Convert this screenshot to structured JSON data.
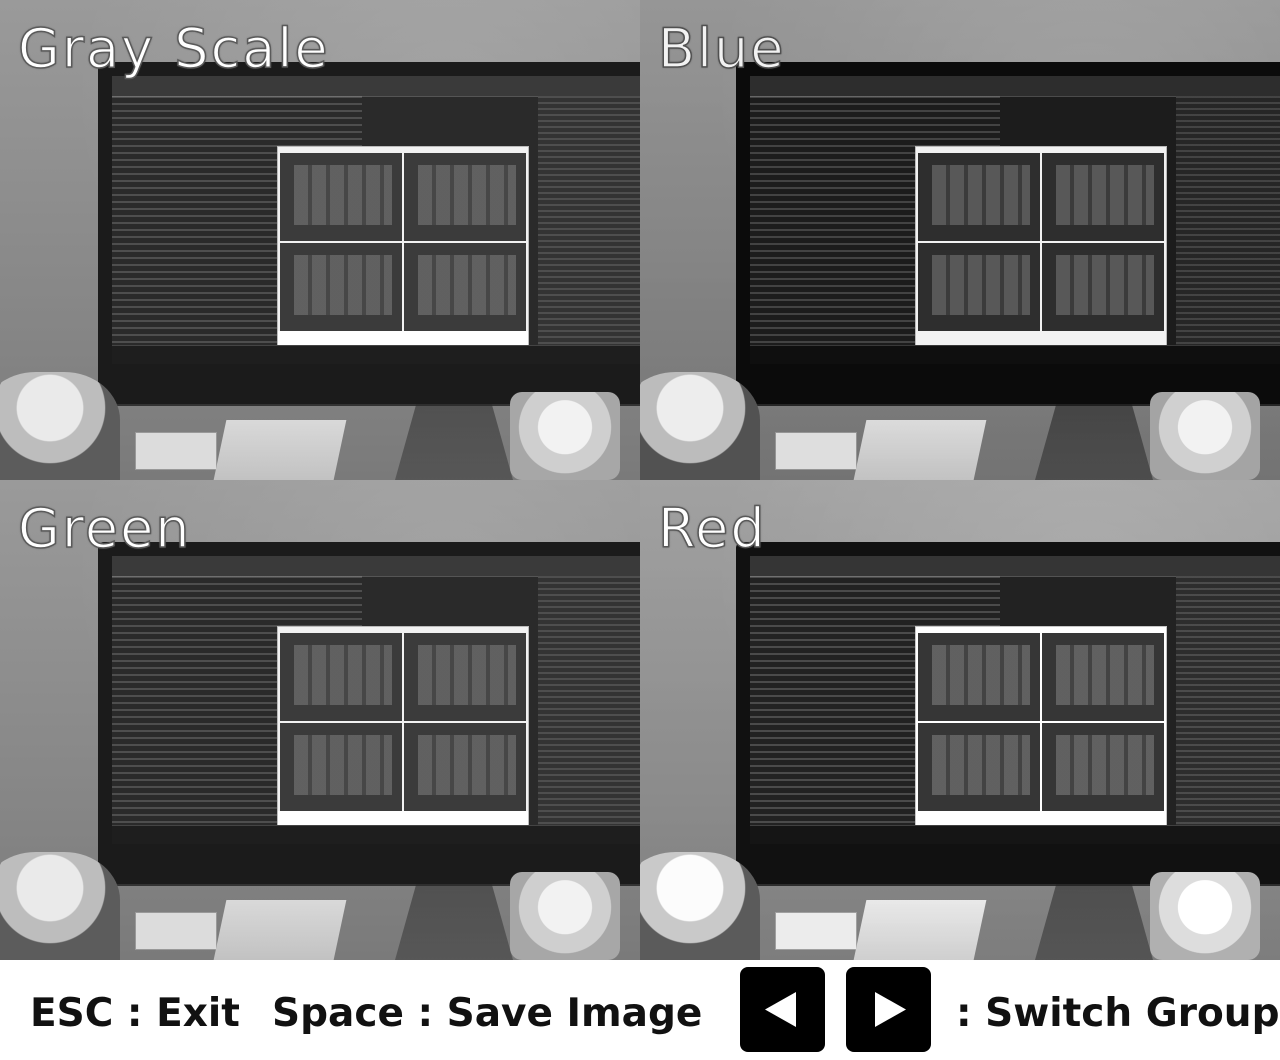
{
  "panels": [
    {
      "id": "gray",
      "label": "Gray Scale"
    },
    {
      "id": "blue",
      "label": "Blue"
    },
    {
      "id": "green",
      "label": "Green"
    },
    {
      "id": "red",
      "label": "Red"
    }
  ],
  "footer": {
    "exit_hint": "ESC : Exit",
    "save_hint": "Space : Save Image",
    "switch_hint": ": Switch Group",
    "prev_icon": "triangle-left-icon",
    "next_icon": "triangle-right-icon"
  }
}
